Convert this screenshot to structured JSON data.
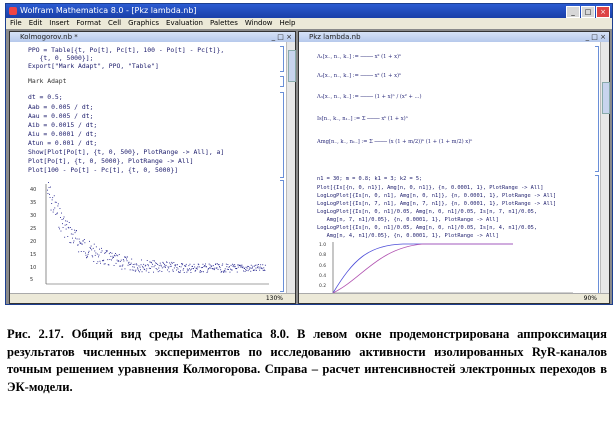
{
  "window": {
    "title": "Wolfram Mathematica 8.0 - [Pkz lambda.nb]"
  },
  "menu": [
    "File",
    "Edit",
    "Insert",
    "Format",
    "Cell",
    "Graphics",
    "Evaluation",
    "Palettes",
    "Window",
    "Help"
  ],
  "left_notebook": {
    "title": "Kolmogorov.nb *",
    "zoom": "130%",
    "code_lines": [
      "PPO = Table[{t, Po[t], Pc[t], 100 - Po[t] - Pc[t]},",
      "   {t, 0, 5000}];",
      "Export[\"Mark Adapt\", PPO, \"Table\"]"
    ],
    "output": "Mark Adapt",
    "code_lines_2": [
      "dt = 0.5;",
      "Aab = 0.005 / dt;",
      "Aau = 0.005 / dt;",
      "Aib = 0.0015 / dt;",
      "Aiu = 0.0001 / dt;",
      "Atun = 0.001 / dt;",
      "Show[Plot[Po[t], {t, 0, 500}, PlotRange -> All], a]",
      "Plot[Po[t], {t, 0, 5000}, PlotRange -> All]",
      "Plot[100 - Po[t] - Pc[t], {t, 0, 5000}]"
    ],
    "plot_yticks": [
      "40",
      "35",
      "30",
      "25",
      "20",
      "15",
      "10",
      "5"
    ]
  },
  "right_notebook": {
    "title": "Pkz lambda.nb",
    "zoom": "90%",
    "code_lines": [
      "n1 = 30; m = 0.8; k1 = 3; k2 = 5;",
      "Plot[{Is[{n, 0, n1}], Amg[n, 0, n1]}, {n, 0.0001, 1}, PlotRange -> All]",
      "LogLogPlot[{Is[n, 0, n1], Amg[n, 0, n1]}, {n, 0.0001, 1}, PlotRange -> All]",
      "LogLogPlot[{Is[n, 7, n1], Amg[n, 7, n1]}, {n, 0.0001, 1}, PlotRange -> All]",
      "LogLogPlot[{Is[n, 0, n1]/0.05, Amg[n, 0, n1]/0.05, Is[n, 7, n1]/0.05,",
      "   Amg[n, 7, n1]/0.05}, {n, 0.0001, 1}, PlotRange -> All]",
      "LogLogPlot[{Is[n, 0, n1]/0.05, Amg[n, 0, n1]/0.05, Is[n, 4, n1]/0.05,",
      "   Amg[n, 4, n1]/0.05}, {n, 0.0001, 1}, PlotRange -> All]"
    ],
    "plot_yticks": [
      "1.0",
      "0.8",
      "0.6",
      "0.4",
      "0.2"
    ]
  },
  "caption": "Рис. 2.17. Общий вид среды Mathematica 8.0. В левом окне продемонстрирована аппроксимация результатов численных экспериментов по исследованию активности изолированных RyR-каналов точным решением уравнения Колмогорова. Справа – расчет интенсивностей электронных переходов в ЭК-модели.",
  "colors": {
    "curve_blue": "#4a4ad8",
    "curve_purple": "#b050b0",
    "plot_points": "#1a1a8a",
    "titlebar": "#2b5bd1"
  }
}
